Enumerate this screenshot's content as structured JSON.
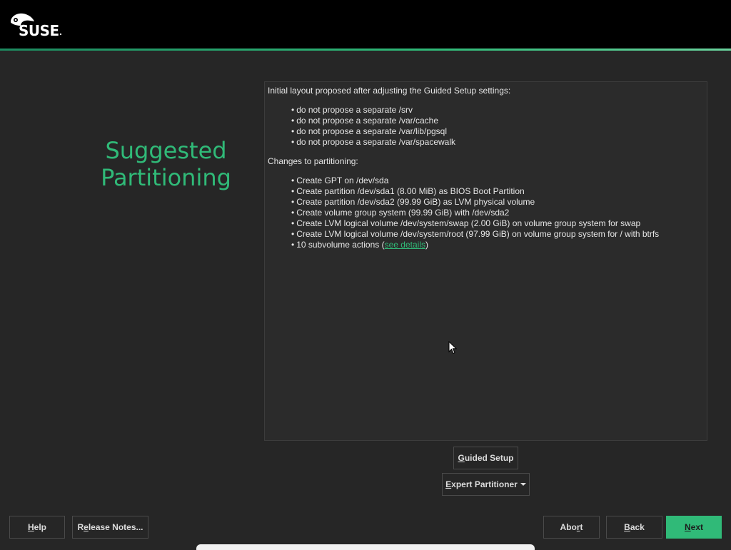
{
  "header": {
    "logo_text": "SUSE"
  },
  "page": {
    "title_line1": "Suggested",
    "title_line2": "Partitioning"
  },
  "summary": {
    "intro": "Initial layout proposed after adjusting the Guided Setup settings:",
    "settings": [
      "do not propose a separate /srv",
      "do not propose a separate /var/cache",
      "do not propose a separate /var/lib/pgsql",
      "do not propose a separate /var/spacewalk"
    ],
    "changes_heading": "Changes to partitioning:",
    "changes": [
      "Create GPT on /dev/sda",
      "Create partition /dev/sda1 (8.00 MiB) as BIOS Boot Partition",
      "Create partition /dev/sda2 (99.99 GiB) as LVM physical volume",
      "Create volume group system (99.99 GiB) with /dev/sda2",
      "Create LVM logical volume /dev/system/swap (2.00 GiB) on volume group system for swap",
      "Create LVM logical volume /dev/system/root (97.99 GiB) on volume group system for / with btrfs"
    ],
    "subvolume_prefix": "10 subvolume actions (",
    "subvolume_link": "see details",
    "subvolume_suffix": ")"
  },
  "buttons": {
    "guided_setup_key": "G",
    "guided_setup_rest": "uided Setup",
    "expert_key": "E",
    "expert_rest": "xpert Partitioner",
    "help_key": "H",
    "help_rest": "elp",
    "release_pre": "R",
    "release_key": "e",
    "release_rest": "lease Notes...",
    "abort_pre": "Abo",
    "abort_key": "r",
    "abort_rest": "t",
    "back_key": "B",
    "back_rest": "ack",
    "next_key": "N",
    "next_rest": "ext"
  },
  "colors": {
    "accent": "#30ba78",
    "header_bg": "#000000",
    "background": "#262626"
  },
  "icons": [
    "suse-chameleon-logo-icon",
    "mouse-cursor-icon",
    "caret-down-icon"
  ]
}
